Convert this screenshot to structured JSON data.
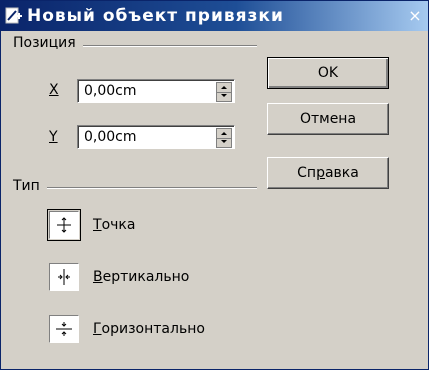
{
  "window": {
    "title": "Новый объект привязки",
    "close_symbol": "×",
    "title_gradient": [
      "#0a246a",
      "#a6caf0"
    ]
  },
  "position_group": {
    "label": "Позиция",
    "x_label": "X",
    "x_value": "0,00cm",
    "y_label": "Y",
    "y_value": "0,00cm"
  },
  "type_group": {
    "label": "Тип",
    "options": [
      {
        "mnemonic": "Т",
        "rest": "очка",
        "icon": "point-snap-icon",
        "selected": true
      },
      {
        "mnemonic": "В",
        "rest": "ертикально",
        "icon": "vertical-snap-icon",
        "selected": false
      },
      {
        "mnemonic": "Г",
        "rest": "оризонтально",
        "icon": "horizontal-snap-icon",
        "selected": false
      }
    ]
  },
  "buttons": {
    "ok": "OK",
    "cancel": "Отмена",
    "help_before": "Сп",
    "help_mnemonic": "р",
    "help_after": "авка"
  }
}
